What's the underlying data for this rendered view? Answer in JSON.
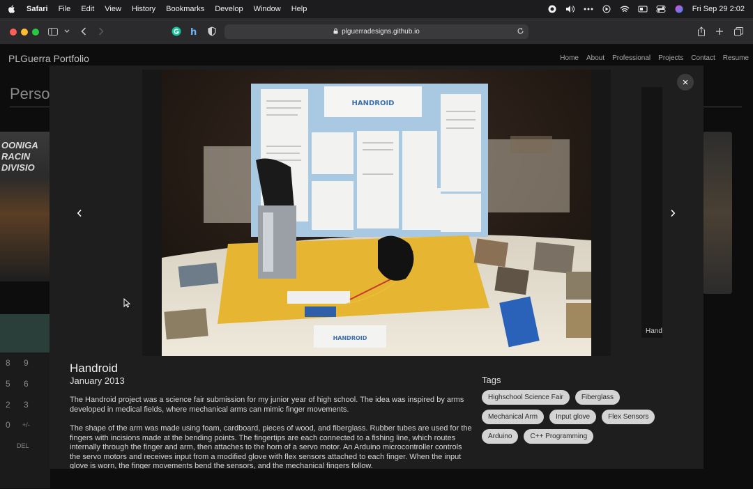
{
  "menubar": {
    "items": [
      "Safari",
      "File",
      "Edit",
      "View",
      "History",
      "Bookmarks",
      "Develop",
      "Window",
      "Help"
    ],
    "clock": "Fri Sep 29  2:02"
  },
  "browser": {
    "url": "plguerradesigns.github.io"
  },
  "site": {
    "brand": "PLGuerra Portfolio",
    "nav": [
      "Home",
      "About",
      "Professional",
      "Projects",
      "Contact",
      "Resume"
    ],
    "heading_partial": "Perso",
    "bg_thumb_text": "OONIGA\nRACIN\nDIVISIO",
    "calc_keys": [
      "8",
      "9",
      "5",
      "6",
      "2",
      "3",
      "0",
      "+/-",
      "DEL"
    ]
  },
  "lightbox": {
    "close_label": "×",
    "next_peek_label": "Hand",
    "project": {
      "title": "Handroid",
      "date": "January 2013",
      "paragraphs": [
        "The Handroid project was a science fair submission for my junior year of high school. The idea was inspired by arms developed in medical fields, where mechanical arms can mimic finger movements.",
        "The shape of the arm was made using foam, cardboard, pieces of wood, and fiberglass. Rubber tubes are used for the fingers with incisions made at the bending points. The fingertips are each connected to a fishing line, which routes internally through the finger and arm, then attaches to the horn of a servo motor. An Arduino microcontroller controls the servo motors and receives input from a modified glove with flex sensors attached to each finger. When the input glove is worn, the finger movements bend the sensors, and the mechanical fingers follow."
      ]
    },
    "tags_heading": "Tags",
    "tags": [
      "Highschool Science Fair",
      "Fiberglass",
      "Mechanical Arm",
      "Input glove",
      "Flex Sensors",
      "Arduino",
      "C++ Programming"
    ],
    "poster_title": "HANDROID"
  }
}
